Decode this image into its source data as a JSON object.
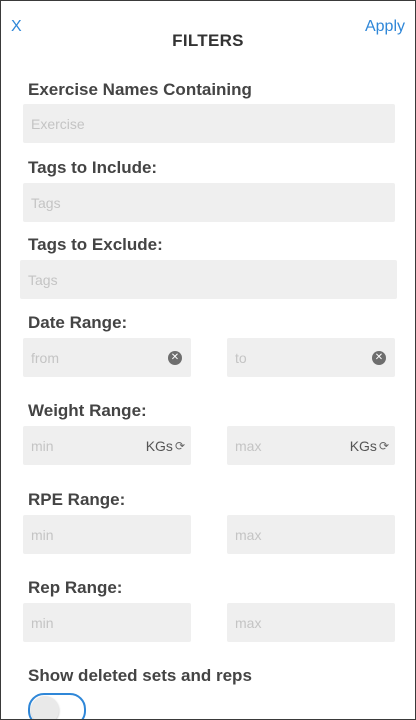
{
  "header": {
    "close_label": "X",
    "title": "FILTERS",
    "apply_label": "Apply"
  },
  "exercise": {
    "label": "Exercise Names Containing",
    "placeholder": "Exercise"
  },
  "tags_include": {
    "label": "Tags to Include:",
    "placeholder": "Tags"
  },
  "tags_exclude": {
    "label": "Tags to Exclude:",
    "placeholder": "Tags"
  },
  "date_range": {
    "label": "Date Range:",
    "from_placeholder": "from",
    "to_placeholder": "to",
    "clear_icon": "clear-circle-icon"
  },
  "weight_range": {
    "label": "Weight Range:",
    "min_placeholder": "min",
    "max_placeholder": "max",
    "unit": "KGs",
    "unit_icon": "refresh-icon"
  },
  "rpe_range": {
    "label": "RPE Range:",
    "min_placeholder": "min",
    "max_placeholder": "max"
  },
  "rep_range": {
    "label": "Rep Range:",
    "min_placeholder": "min",
    "max_placeholder": "max"
  },
  "show_deleted": {
    "label": "Show deleted sets and reps",
    "enabled": false
  },
  "colors": {
    "accent": "#2f87d8",
    "field_bg": "#efefef",
    "placeholder": "#c4c4c4"
  }
}
